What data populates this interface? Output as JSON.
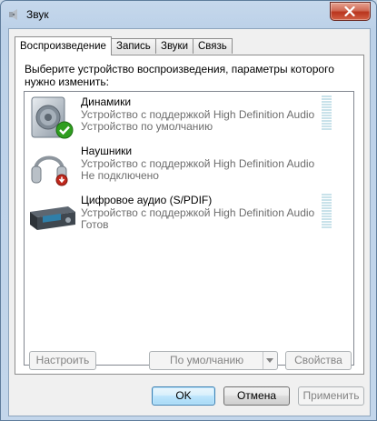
{
  "window": {
    "title": "Звук",
    "icon": "speaker-icon",
    "close_icon": "close-icon"
  },
  "tabs": [
    {
      "label": "Воспроизведение",
      "active": true
    },
    {
      "label": "Запись",
      "active": false
    },
    {
      "label": "Звуки",
      "active": false
    },
    {
      "label": "Связь",
      "active": false
    }
  ],
  "playback": {
    "instruction": "Выберите устройство воспроизведения, параметры которого нужно изменить:",
    "devices": [
      {
        "name": "Динамики",
        "description": "Устройство с поддержкой High Definition Audio",
        "status": "Устройство по умолчанию",
        "icon": "speakers-icon",
        "badge": "default-check-icon",
        "level_meter": true
      },
      {
        "name": "Наушники",
        "description": "Устройство с поддержкой High Definition Audio",
        "status": "Не подключено",
        "icon": "headphones-icon",
        "badge": "disconnected-icon",
        "level_meter": false
      },
      {
        "name": "Цифровое аудио (S/PDIF)",
        "description": "Устройство с поддержкой High Definition Audio",
        "status": "Готов",
        "icon": "digital-audio-icon",
        "badge": "",
        "level_meter": true
      }
    ],
    "configure_label": "Настроить",
    "set_default_label": "По умолчанию",
    "properties_label": "Свойства"
  },
  "footer": {
    "ok_label": "OK",
    "cancel_label": "Отмена",
    "apply_label": "Применить"
  },
  "colors": {
    "window_frame": "#c6d8ec",
    "close_button": "#c7432b",
    "secondary_text": "#6d6d6d",
    "meter": "#c9e2ea",
    "default_badge": "#2f9e1f",
    "disconnected_badge": "#c0281d"
  }
}
